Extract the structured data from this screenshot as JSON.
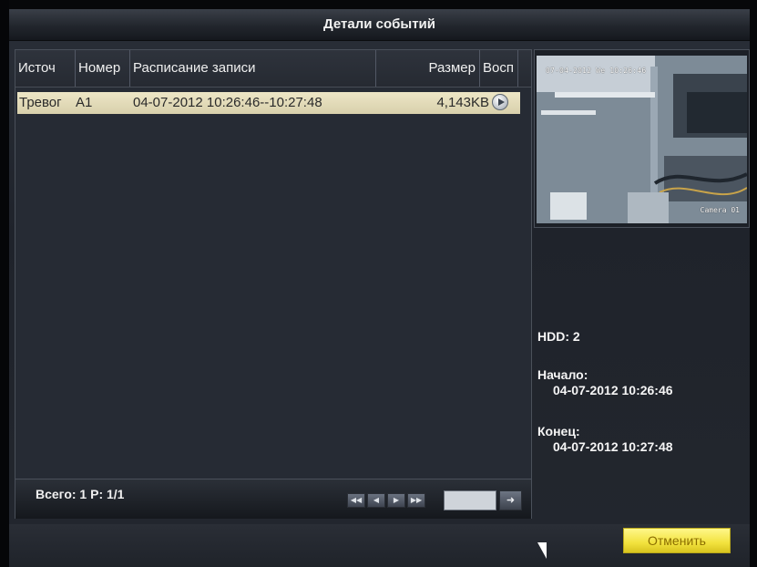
{
  "window": {
    "title": "Детали событий"
  },
  "table": {
    "columns": [
      "Источ",
      "Номер",
      "Расписание записи",
      "Размер",
      "Восп"
    ],
    "rows": [
      {
        "source": "Тревог",
        "number": "A1",
        "schedule": "04-07-2012 10:26:46--10:27:48",
        "size": "4,143KB",
        "action_icon": "play-icon"
      }
    ]
  },
  "pagination": {
    "total_label": "Всего: 1  P: 1/1",
    "page_input": "",
    "buttons": [
      "first-page-icon",
      "prev-page-icon",
      "next-page-icon",
      "last-page-icon",
      "go-arrow-icon"
    ]
  },
  "preview": {
    "osd_time": "07-04-2012 We 10:26:46",
    "camera_label": "Camera 01"
  },
  "details": {
    "hdd": "HDD: 2",
    "start_label": "Начало:",
    "start_value": "04-07-2012 10:26:46",
    "end_label": "Конец:",
    "end_value": "04-07-2012 10:27:48"
  },
  "buttons": {
    "cancel": "Отменить"
  },
  "colors": {
    "selected_row": "#e6dfbf",
    "cancel_button": "#f2e23e",
    "panel_bg": "#262b34"
  }
}
